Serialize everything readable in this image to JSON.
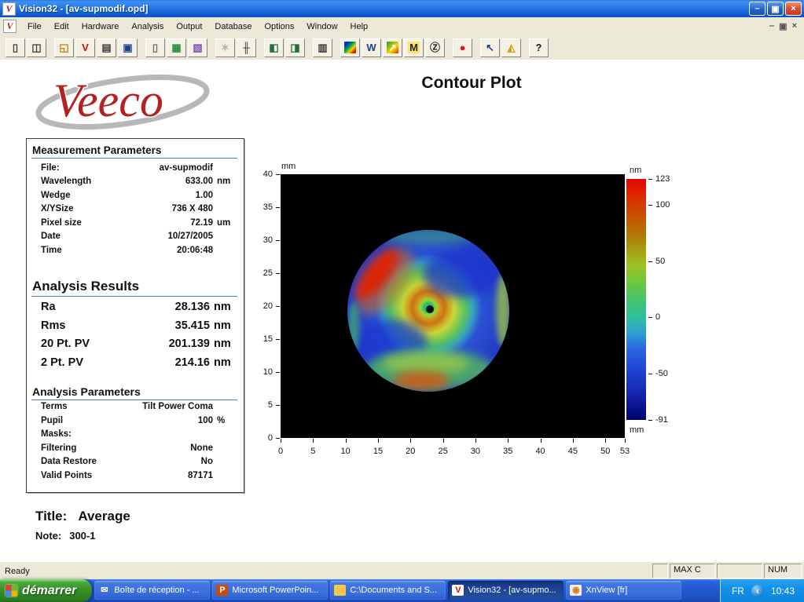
{
  "window": {
    "title": "Vision32 - [av-supmodif.opd]",
    "app_icon_glyph": "V",
    "buttons": {
      "minimize": "–",
      "restore": "▣",
      "close": "×"
    }
  },
  "menubar": {
    "items": [
      "File",
      "Edit",
      "Hardware",
      "Analysis",
      "Output",
      "Database",
      "Options",
      "Window",
      "Help"
    ],
    "mdi": {
      "minimize": "‒",
      "restore": "▣",
      "close": "×"
    }
  },
  "toolbar": {
    "buttons": [
      {
        "name": "new-document-button",
        "icon": "new-document-icon",
        "glyph": "▯",
        "fg": "#3a3a3a"
      },
      {
        "name": "new-database-document-button",
        "icon": "new-database-document-icon",
        "glyph": "◫",
        "fg": "#3a3a3a"
      },
      {
        "gap": true
      },
      {
        "name": "open-button",
        "icon": "open-folder-icon",
        "glyph": "◱",
        "fg": "#b8860b"
      },
      {
        "name": "open-opd-file-button",
        "icon": "opd-file-icon",
        "glyph": "V",
        "fg": "#cc1111"
      },
      {
        "name": "print-button",
        "icon": "printer-icon",
        "glyph": "▤",
        "fg": "#3a3a3a"
      },
      {
        "name": "save-button",
        "icon": "floppy-disk-icon",
        "glyph": "▣",
        "fg": "#1e3f8f"
      },
      {
        "gap": true
      },
      {
        "name": "copy-data-button",
        "icon": "page-copy-icon",
        "glyph": "▯",
        "fg": "#6a6a6a"
      },
      {
        "name": "dataset-button",
        "icon": "dataset-grid-icon",
        "glyph": "▦",
        "fg": "#22903c"
      },
      {
        "name": "mask-editor-button",
        "icon": "mask-icon",
        "glyph": "▧",
        "fg": "#7a4fb0"
      },
      {
        "gap": true
      },
      {
        "name": "measure-button",
        "icon": "star-burst-icon",
        "glyph": "✶",
        "fg": "#b8b4a2",
        "disabled": true
      },
      {
        "name": "trim-filter-button",
        "icon": "trim-filter-icon",
        "glyph": "╫",
        "fg": "#3a3a3a"
      },
      {
        "gap": true
      },
      {
        "name": "tile-windows-button",
        "icon": "window-tile-icon",
        "glyph": "◧",
        "fg": "#1e6f3c"
      },
      {
        "name": "cascade-windows-button",
        "icon": "window-cascade-icon",
        "glyph": "◨",
        "fg": "#1e6f3c"
      },
      {
        "gap": true
      },
      {
        "name": "copy-page-button",
        "icon": "copy-pages-icon",
        "glyph": "▥",
        "fg": "#3a3a3a"
      },
      {
        "gap": true
      },
      {
        "name": "contour-plot-button",
        "icon": "contour-plot-icon",
        "glyph": "",
        "fg": "#ffffff",
        "bg": "linear-gradient(135deg,#0033cc 20%,#00aa44 45%,#ffd400 65%,#cc2200 85%)"
      },
      {
        "name": "profile-plot-button",
        "icon": "profile-plot-icon",
        "glyph": "W",
        "fg": "#1e3f8f"
      },
      {
        "name": "surface-3d-plot-button",
        "icon": "surface-3d-icon",
        "glyph": "↗",
        "fg": "#ffffff",
        "bg": "linear-gradient(135deg,#1f9e2c,#ffd400 60%,#d23000)"
      },
      {
        "name": "m-analysis-button",
        "icon": "m-icon",
        "glyph": "M",
        "fg": "#222222",
        "bg": "#ffe566"
      },
      {
        "name": "zernike-button",
        "icon": "z-circle-icon",
        "glyph": "Ⓩ",
        "fg": "#222222"
      },
      {
        "gap": true
      },
      {
        "name": "record-button",
        "icon": "record-dot-icon",
        "glyph": "●",
        "fg": "#e81123"
      },
      {
        "gap": true
      },
      {
        "name": "pointer-tool-button",
        "icon": "pointer-arrow-icon",
        "glyph": "↖",
        "fg": "#1e3f8f"
      },
      {
        "name": "analysis-tools-button",
        "icon": "flask-icon",
        "glyph": "◭",
        "fg": "#caa416"
      },
      {
        "gap": true
      },
      {
        "name": "help-button",
        "icon": "help-question-icon",
        "glyph": "?",
        "fg": "#222222"
      }
    ]
  },
  "report": {
    "logo_text": "Veeco",
    "page_title": "Contour Plot",
    "measurement_parameters": {
      "heading": "Measurement Parameters",
      "rows": [
        {
          "label": "File:",
          "value": "av-supmodif",
          "unit": ""
        },
        {
          "label": "Wavelength",
          "value": "633.00",
          "unit": "nm"
        },
        {
          "label": "Wedge",
          "value": "1.00",
          "unit": ""
        },
        {
          "label": "X/YSize",
          "value": "736 X 480",
          "unit": ""
        },
        {
          "label": "Pixel size",
          "value": "72.19",
          "unit": "um"
        },
        {
          "label": "Date",
          "value": "10/27/2005",
          "unit": ""
        },
        {
          "label": "Time",
          "value": "20:06:48",
          "unit": ""
        }
      ]
    },
    "analysis_results": {
      "heading": "Analysis Results",
      "rows": [
        {
          "label": "Ra",
          "value": "28.136",
          "unit": "nm"
        },
        {
          "label": "Rms",
          "value": "35.415",
          "unit": "nm"
        },
        {
          "label": "20 Pt. PV",
          "value": "201.139",
          "unit": "nm"
        },
        {
          "label": "2 Pt. PV",
          "value": "214.16",
          "unit": "nm"
        }
      ]
    },
    "analysis_parameters": {
      "heading": "Analysis Parameters",
      "rows": [
        {
          "label": "Terms",
          "value": "Tilt Power Coma",
          "unit": ""
        },
        {
          "label": "Pupil",
          "value": "100",
          "unit": "%"
        },
        {
          "label": "Masks:",
          "value": "",
          "unit": ""
        },
        {
          "label": "Filtering",
          "value": "None",
          "unit": ""
        },
        {
          "label": "Data Restore",
          "value": "No",
          "unit": ""
        },
        {
          "label": "Valid Points",
          "value": "87171",
          "unit": ""
        }
      ]
    },
    "title_line": {
      "label": "Title:",
      "value": "Average"
    },
    "note_line": {
      "label": "Note:",
      "value": "300-1"
    }
  },
  "chart_data": {
    "type": "heatmap",
    "title": "Contour Plot",
    "x_unit": "mm",
    "y_unit": "mm",
    "z_unit": "nm",
    "xlim": [
      0,
      53
    ],
    "ylim": [
      0,
      40
    ],
    "x_ticks": [
      0,
      5,
      10,
      15,
      20,
      25,
      30,
      35,
      40,
      45,
      50,
      53
    ],
    "y_ticks": [
      40,
      35,
      30,
      25,
      20,
      15,
      10,
      5,
      0
    ],
    "colorbar": {
      "ticks": [
        123,
        100,
        50,
        0,
        -50,
        -91
      ],
      "max": 123,
      "min": -91,
      "unit": "nm"
    },
    "plot_background": "#000000",
    "disk": {
      "center_mm": [
        22.7,
        19.6
      ],
      "radius_mm": 12.7
    },
    "features": [
      "circular surface-height map of a polished part on black background",
      "bright red high spot (~+120 nm) on upper-left rim",
      "dark blue low regions (~-60 nm) upper-right and lower-left",
      "concentric yellow-orange ridge ring (~+60 nm) around center",
      "small teal zone with dark invalid-data dot at disk center",
      "orange patch at bottom edge and yellow-green arc on right rim"
    ]
  },
  "statusbar": {
    "message": "Ready",
    "cells": [
      "",
      "MAX C",
      "",
      "NUM"
    ]
  },
  "taskbar": {
    "start_label": "démarrer",
    "tasks": [
      {
        "name": "task-outlook-express",
        "icon": "envelope-icon",
        "label": "Boîte de réception - ...",
        "glyph": "✉",
        "fg": "#ffffff"
      },
      {
        "name": "task-powerpoint",
        "icon": "powerpoint-icon",
        "label": "Microsoft PowerPoin...",
        "glyph": "P",
        "fg": "#ffffff",
        "bg": "#d04a02"
      },
      {
        "name": "task-explorer",
        "icon": "folder-icon",
        "label": "C:\\Documents and S...",
        "glyph": "",
        "bg": "#f6c64a"
      },
      {
        "name": "task-vision32",
        "icon": "vision32-icon",
        "label": "Vision32 - [av-supmo...",
        "glyph": "V",
        "fg": "#cc1111",
        "bg": "#ffffff",
        "active": true
      },
      {
        "name": "task-xnview",
        "icon": "xnview-icon",
        "label": "XnView [fr]",
        "glyph": "◉",
        "fg": "#e07820",
        "bg": "#f4f0e4"
      }
    ],
    "tray": {
      "language": "FR",
      "hide_glyph": "‹",
      "time": "10:43"
    }
  }
}
